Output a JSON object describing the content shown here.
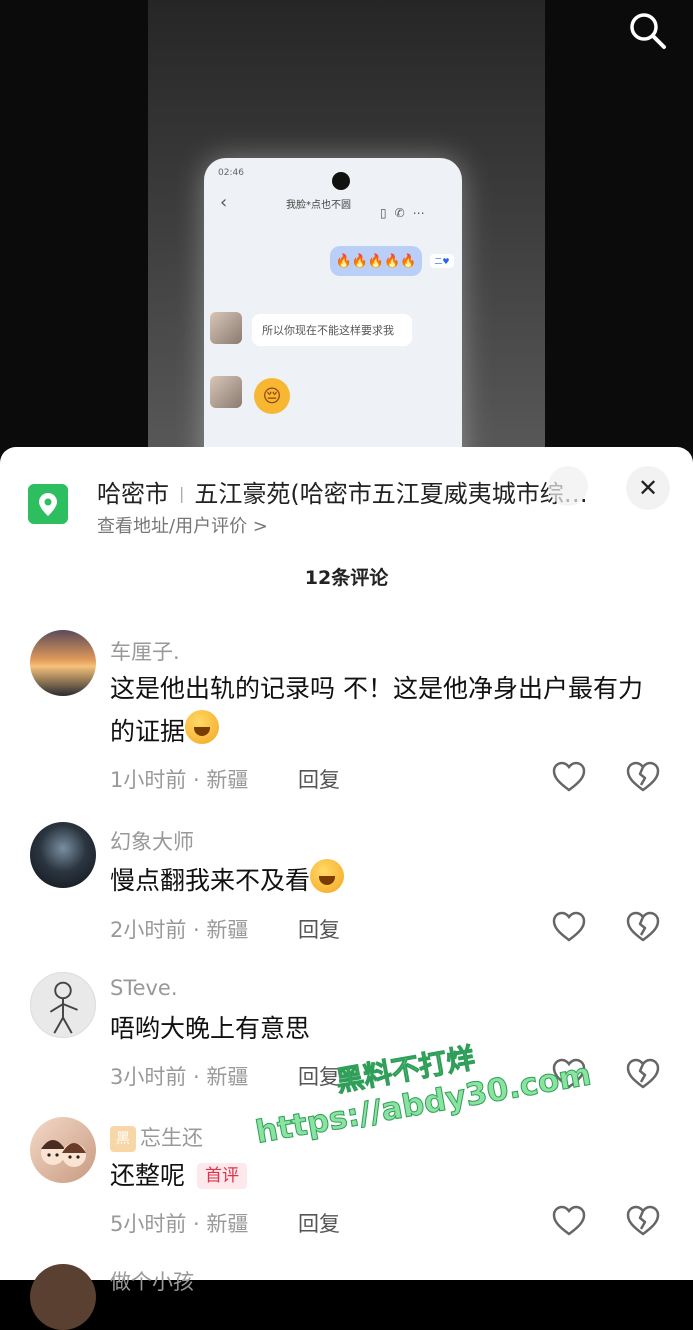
{
  "video": {
    "phone_time": "02:46",
    "chat_title": "我脸*点也不圆",
    "chat_subtitle": "",
    "sent_emojis": "🔥🔥🔥🔥🔥",
    "sent_tag": "二♥",
    "received_text": "所以你现在不能这样要求我",
    "received_emoji": "😔"
  },
  "location": {
    "city": "哈密市",
    "place": "五江豪苑(哈密市五江夏威夷城市综…",
    "sub": "查看地址/用户评价 >"
  },
  "comments_header": "12条评论",
  "comments": [
    {
      "name": "车厘子.",
      "text": "这是他出轨的记录吗 不！这是他净身出户最有力的证据",
      "time": "1小时前",
      "region": "新疆",
      "reply": "回复"
    },
    {
      "name": "幻象大师",
      "text": "慢点翻我来不及看",
      "time": "2小时前",
      "region": "新疆",
      "reply": "回复"
    },
    {
      "name": "STeve.",
      "text": "唔哟大晚上有意思",
      "time": "3小时前",
      "region": "新疆",
      "reply": "回复"
    },
    {
      "name": "忘生还",
      "fan_badge": "黑",
      "text": "还整呢",
      "badge": "首评",
      "time": "5小时前",
      "region": "新疆",
      "reply": "回复"
    },
    {
      "name": "做个小孩",
      "text": "",
      "time": "",
      "region": "",
      "reply": ""
    }
  ],
  "watermark": {
    "line1": "黑料不打烊",
    "line2": "https://abdy30.com"
  },
  "icons": {
    "search": "search-icon",
    "location": "location-pin-icon",
    "close": "close-icon",
    "like": "heart-icon",
    "dislike": "broken-heart-icon"
  },
  "colors": {
    "location_green": "#2dbe60",
    "accent_red": "#e0314b"
  }
}
